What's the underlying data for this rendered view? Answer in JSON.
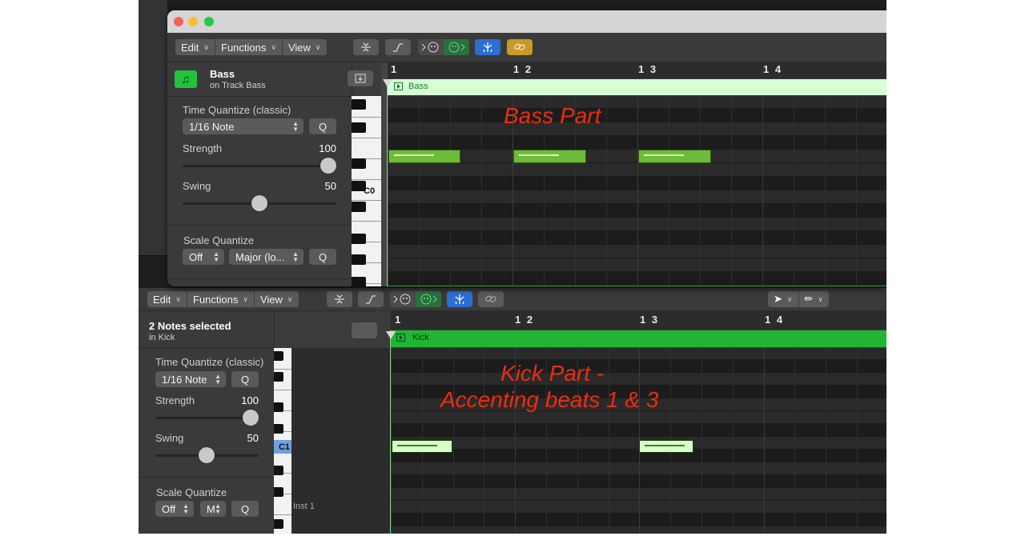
{
  "top_window": {
    "menu": {
      "edit": "Edit",
      "functions": "Functions",
      "view": "View"
    },
    "region_header": {
      "name": "Bass",
      "subtitle": "on Track Bass"
    },
    "time_quantize": {
      "title": "Time Quantize (classic)",
      "value": "1/16 Note",
      "q_label": "Q",
      "strength_label": "Strength",
      "strength_value": "100",
      "strength_level": 1.0,
      "swing_label": "Swing",
      "swing_value": "50",
      "swing_level": 0.5
    },
    "scale_quantize": {
      "title": "Scale Quantize",
      "mode": "Off",
      "scale": "Major (lo...",
      "q_label": "Q"
    },
    "ruler": [
      "1",
      "1 2",
      "1 3",
      "1 4"
    ],
    "region_label": "Bass",
    "key_label": "C0",
    "annotation": "Bass Part",
    "notes": [
      {
        "beat": 1,
        "length_beats": 0.5,
        "pitch": "C#0"
      },
      {
        "beat": 2,
        "length_beats": 0.5,
        "pitch": "C#0"
      },
      {
        "beat": 3,
        "length_beats": 0.5,
        "pitch": "C#0"
      }
    ],
    "colors": {
      "region": "#d6ffd6",
      "note": "#6dbb3a",
      "accent_blue": "#2b6fd1",
      "accent_gold": "#c99a28"
    }
  },
  "bottom_window": {
    "menu": {
      "edit": "Edit",
      "functions": "Functions",
      "view": "View"
    },
    "region_header": {
      "name": "2 Notes selected",
      "subtitle": "in Kick"
    },
    "time_quantize": {
      "title": "Time Quantize (classic)",
      "value": "1/16 Note",
      "q_label": "Q",
      "strength_label": "Strength",
      "strength_value": "100",
      "strength_level": 1.0,
      "swing_label": "Swing",
      "swing_value": "50",
      "swing_level": 0.5
    },
    "scale_quantize": {
      "title": "Scale Quantize",
      "mode": "Off",
      "scale": "M",
      "q_label": "Q"
    },
    "ruler": [
      "1",
      "1 2",
      "1 3",
      "1 4"
    ],
    "region_label": "Kick",
    "key_label": "C1",
    "key_name": "Inst 1",
    "annotation_line1": "Kick Part -",
    "annotation_line2": "Accenting beats 1 & 3",
    "notes": [
      {
        "beat": 1,
        "length_beats": 0.5,
        "pitch": "C1",
        "selected": true
      },
      {
        "beat": 3,
        "length_beats": 0.5,
        "pitch": "C1",
        "selected": true
      }
    ],
    "colors": {
      "region": "#22b534",
      "note_selected": "#d8ffc8",
      "accent_blue": "#2b6fd1"
    }
  }
}
